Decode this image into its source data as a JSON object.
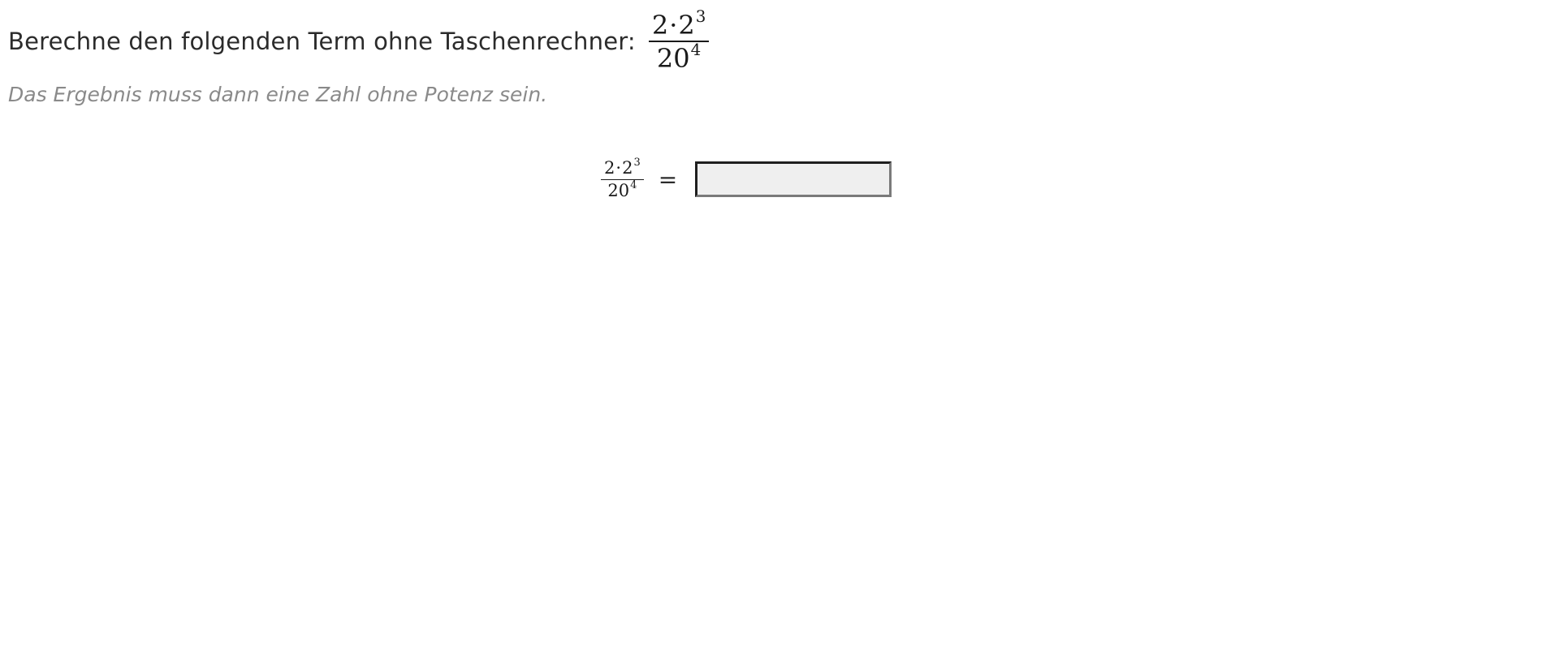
{
  "question": {
    "text": "Berechne den folgenden Term ohne Taschenrechner:",
    "term": {
      "numerator_factor": "2",
      "operator": "·",
      "numerator_base": "2",
      "numerator_exponent": "3",
      "denominator_base": "20",
      "denominator_exponent": "4"
    }
  },
  "hint": "Das Ergebnis muss dann eine Zahl ohne Potenz sein.",
  "answer": {
    "equals": "=",
    "value": "",
    "placeholder": ""
  }
}
